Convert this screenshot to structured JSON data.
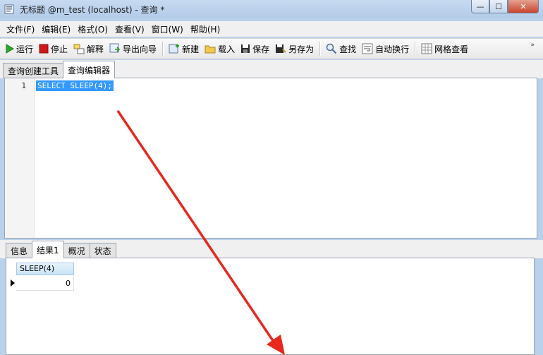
{
  "window": {
    "title": "无标题 @m_test (localhost) - 查询 *",
    "min_glyph": "—",
    "max_glyph": "☐",
    "close_glyph": "✕"
  },
  "menu": [
    "文件(F)",
    "编辑(E)",
    "格式(O)",
    "查看(V)",
    "窗口(W)",
    "帮助(H)"
  ],
  "toolbar": {
    "run": "运行",
    "stop": "停止",
    "explain": "解释",
    "export_wizard": "导出向导",
    "new": "新建",
    "load": "载入",
    "save": "保存",
    "save_as": "另存为",
    "find": "查找",
    "word_wrap": "自动换行",
    "grid_view": "网格查看",
    "overflow": "»"
  },
  "top_tabs": [
    "查询创建工具",
    "查询编辑器"
  ],
  "editor": {
    "line_number": "1",
    "code": "SELECT SLEEP(4);"
  },
  "bottom_tabs": [
    "信息",
    "结果1",
    "概况",
    "状态"
  ],
  "result": {
    "columns": [
      "SLEEP(4)"
    ],
    "rows": [
      [
        "0"
      ]
    ]
  },
  "colors": {
    "selection": "#3399ff",
    "annotation_arrow": "#e8281c",
    "run_icon": "#2fa82f",
    "stop_icon": "#d01818"
  }
}
